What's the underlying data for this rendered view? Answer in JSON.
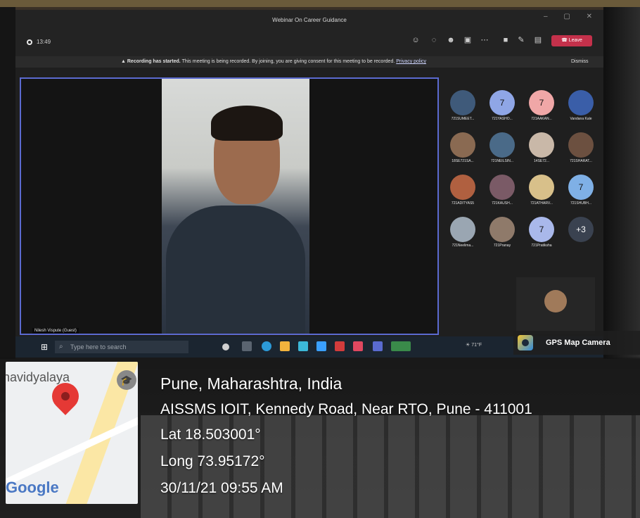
{
  "window": {
    "title": "Webinar On Career Guidance",
    "controls": "– ▢ ✕",
    "timer": "13:49",
    "leave_label": "Leave"
  },
  "recording_banner": {
    "bold": "Recording has started.",
    "text": "This meeting is being recorded. By joining, you are giving consent for this meeting to be recorded.",
    "link": "Privacy policy",
    "dismiss": "Dismiss"
  },
  "speaker": {
    "name": "Nilesh Vispute (Guest)"
  },
  "participants": [
    {
      "name": "721SUMEET...",
      "avatar": "",
      "color": "#3f5a7a"
    },
    {
      "name": "721YASHO...",
      "avatar": "7",
      "color": "#8fa6e6"
    },
    {
      "name": "721AAKAN...",
      "avatar": "7",
      "color": "#f0a7a7"
    },
    {
      "name": "Vandana Kale",
      "avatar": "",
      "color": "#3a5ea8"
    },
    {
      "name": "18SE721SA...",
      "avatar": "",
      "color": "#8a6a52"
    },
    {
      "name": "721NEILSIN...",
      "avatar": "",
      "color": "#4a6a88"
    },
    {
      "name": "14SE72...",
      "avatar": "",
      "color": "#c9b8a8"
    },
    {
      "name": "721SHARAT...",
      "avatar": "",
      "color": "#6c5040"
    },
    {
      "name": "721ADITYAS5",
      "avatar": "",
      "color": "#b06040"
    },
    {
      "name": "721KAUSH...",
      "avatar": "",
      "color": "#7a5a66"
    },
    {
      "name": "721ATHARV...",
      "avatar": "",
      "color": "#d8c08a"
    },
    {
      "name": "721SHUBH...",
      "avatar": "7",
      "color": "#7fb0e6"
    },
    {
      "name": "721Neelima...",
      "avatar": "",
      "color": "#9aa6b2"
    },
    {
      "name": "721Pranay",
      "avatar": "",
      "color": "#8f7a6a"
    },
    {
      "name": "721Pratiksha",
      "avatar": "7",
      "color": "#a9b8ea"
    },
    {
      "name": "",
      "avatar": "+3",
      "color": "#3a4250"
    }
  ],
  "taskbar": {
    "search_placeholder": "Type here to search",
    "weather": "71°F"
  },
  "gps": {
    "badge_label": "GPS Map Camera",
    "map_place": "havidyalaya",
    "map_brand": "Google",
    "location": "Pune, Maharashtra, India",
    "address": "AISSMS IOIT, Kennedy Road, Near RTO, Pune - 411001",
    "lat": "Lat 18.503001°",
    "long": "Long 73.95172°",
    "datetime": "30/11/21 09:55 AM"
  }
}
